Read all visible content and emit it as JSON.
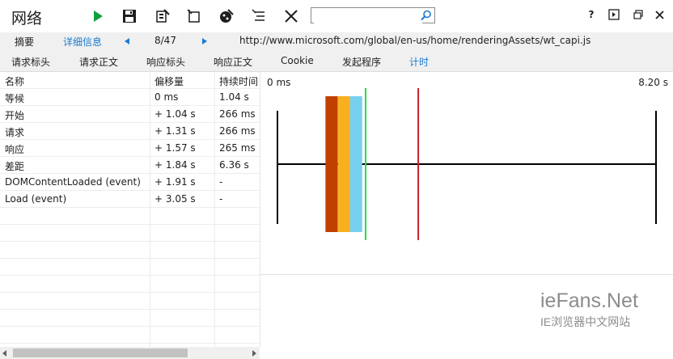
{
  "toolbar": {
    "title": "网络",
    "search": {
      "value": "",
      "placeholder": ""
    },
    "window_buttons": {
      "help": "?"
    }
  },
  "nav": {
    "summary": "摘要",
    "detail": "详细信息",
    "position": "8/47",
    "url": "http://www.microsoft.com/global/en-us/home/renderingAssets/wt_capi.js"
  },
  "tabs": [
    {
      "label": "请求标头"
    },
    {
      "label": "请求正文"
    },
    {
      "label": "响应标头"
    },
    {
      "label": "响应正文"
    },
    {
      "label": "Cookie"
    },
    {
      "label": "发起程序"
    },
    {
      "label": "计时",
      "active": true
    }
  ],
  "table": {
    "headers": [
      "名称",
      "偏移量",
      "持续时间"
    ],
    "rows": [
      [
        "等候",
        "0 ms",
        "1.04 s"
      ],
      [
        "开始",
        "+ 1.04 s",
        "266 ms"
      ],
      [
        "请求",
        "+ 1.31 s",
        "266 ms"
      ],
      [
        "响应",
        "+ 1.57 s",
        "265 ms"
      ],
      [
        "差距",
        "+ 1.84 s",
        "6.36 s"
      ],
      [
        "DOMContentLoaded (event)",
        "+ 1.91 s",
        "-"
      ],
      [
        "Load (event)",
        "+ 3.05 s",
        "-"
      ]
    ]
  },
  "timeline": {
    "start_label": "0 ms",
    "end_label": "8.20 s",
    "total_s": 8.2,
    "segments": [
      {
        "name": "开始",
        "start_s": 1.04,
        "dur_s": 0.266,
        "color": "#c04000"
      },
      {
        "name": "请求",
        "start_s": 1.31,
        "dur_s": 0.266,
        "color": "#f8b020"
      },
      {
        "name": "响应",
        "start_s": 1.57,
        "dur_s": 0.265,
        "color": "#78d0f0"
      }
    ],
    "events": [
      {
        "name": "DOMContentLoaded",
        "at_s": 1.91,
        "color": "#20e040"
      },
      {
        "name": "Load",
        "at_s": 3.05,
        "color": "#c8202a"
      }
    ]
  },
  "watermark": {
    "main": "ieFans.Net",
    "sub": "IE浏览器中文网站"
  },
  "colors": {
    "accent": "#1a7bd0",
    "play": "#10a040"
  }
}
